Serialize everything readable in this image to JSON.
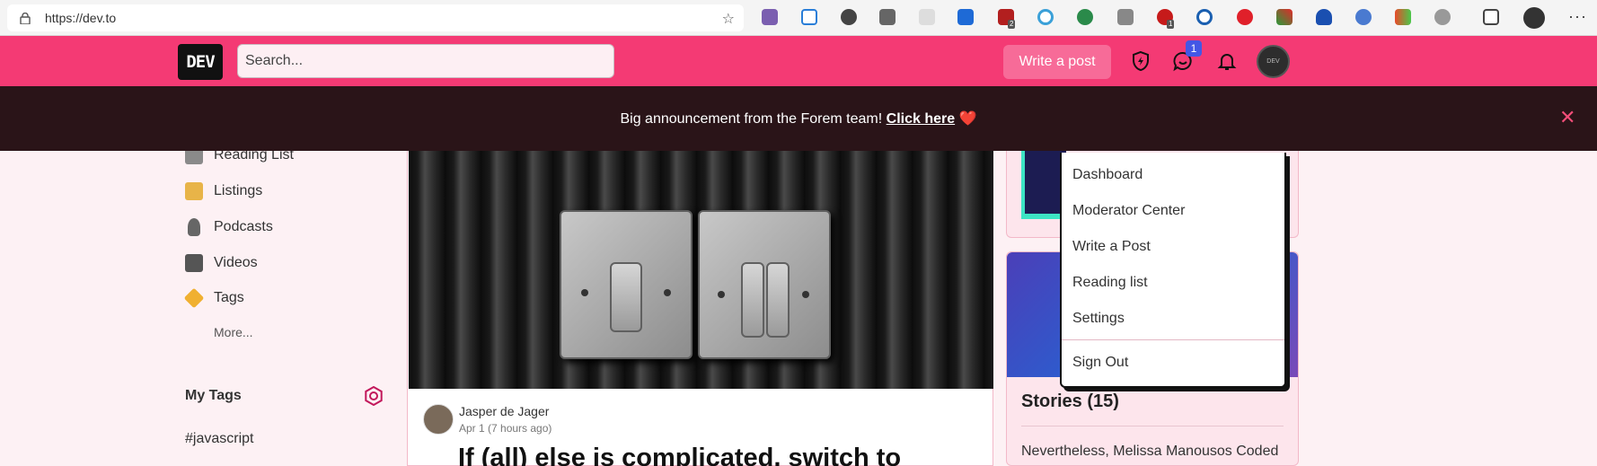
{
  "browser": {
    "url": "https://dev.to",
    "extension_badges": [
      "2",
      "1"
    ]
  },
  "header": {
    "logo": "DEV",
    "search_placeholder": "Search...",
    "write_post": "Write a post",
    "notification_count": "1",
    "avatar_text": "DEV"
  },
  "announcement": {
    "text": "Big announcement from the Forem team!",
    "link": "Click here",
    "heart": "❤️"
  },
  "sidebar": {
    "items": [
      {
        "label": "Reading List",
        "icon": "reading-list-icon"
      },
      {
        "label": "Listings",
        "icon": "listings-icon"
      },
      {
        "label": "Podcasts",
        "icon": "microphone-icon"
      },
      {
        "label": "Videos",
        "icon": "video-camera-icon"
      },
      {
        "label": "Tags",
        "icon": "tag-icon"
      }
    ],
    "more": "More...",
    "my_tags_heading": "My Tags",
    "tags": [
      "#javascript"
    ]
  },
  "article": {
    "author": "Jasper de Jager",
    "date": "Apr 1 (7 hours ago)",
    "title": "If (all) else is complicated, switch to"
  },
  "right": {
    "stories_heading": "Stories (15)",
    "story_1": "Nevertheless, Melissa Manousos Coded"
  },
  "dropdown": {
    "items": [
      "Dashboard",
      "Moderator Center",
      "Write a Post",
      "Reading list",
      "Settings"
    ],
    "sign_out": "Sign Out"
  },
  "colors": {
    "brand": "#f43a74",
    "announcement_bg": "#2a1418",
    "notification_badge": "#4357e5"
  }
}
